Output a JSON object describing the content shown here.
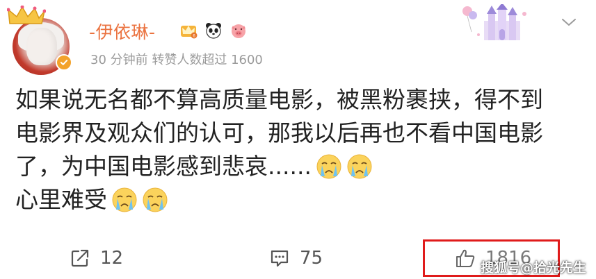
{
  "post": {
    "username": "-伊依琳-",
    "meta": "30 分钟前  转赞人数超过 1600",
    "lines": [
      "如果说无名都不算高质量电影，被黑粉裹挟，得不到",
      "电影界及观众们的认可，那我以后再也不看中国电影",
      "了，为中国电影感到悲哀......",
      "心里难受"
    ]
  },
  "actions": {
    "share_count": "12",
    "comment_count": "75",
    "like_count": "1816"
  },
  "watermark": "搜狐号@拾光先生",
  "icons": {
    "crown": "crown-icon",
    "verified": "verified-badge-icon",
    "emoji": "crying-face-emoji",
    "share": "share-icon",
    "comment": "comment-icon",
    "like": "thumbs-up-icon",
    "more": "chevron-down-icon"
  },
  "colors": {
    "username": "#eb7340",
    "meta": "#9b9b9b",
    "highlight_box": "#e01b1b"
  }
}
